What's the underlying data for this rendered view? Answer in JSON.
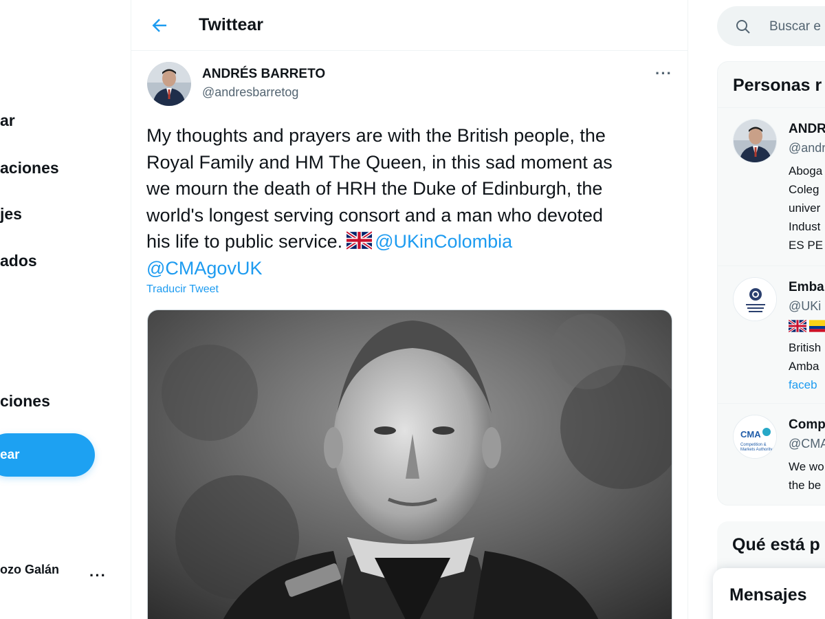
{
  "sidebar": {
    "items": [
      {
        "label": "ar"
      },
      {
        "label": "aciones"
      },
      {
        "label": "jes"
      },
      {
        "label": "ados"
      },
      {
        "label": "ciones"
      }
    ],
    "tweet_button": "ear",
    "account": {
      "name": "ozo Galán",
      "handle": "",
      "more": "···"
    }
  },
  "header": {
    "title": "Twittear"
  },
  "tweet": {
    "author_name": "ANDRÉS BARRETO",
    "author_handle": "@andresbarretog",
    "more": "···",
    "text_line1": "My thoughts and prayers are with the British people, the",
    "text_line2": "Royal Family and HM The Queen, in this sad moment as",
    "text_line3": "we mourn the death of HRH the Duke of Edinburgh, the",
    "text_line4": "world's longest serving consort and a man who devoted",
    "text_line5": "his life to public service.",
    "mention1": "@UKinColombia",
    "mention2": "@CMAgovUK",
    "translate": "Traducir Tweet"
  },
  "search": {
    "placeholder": "Buscar e"
  },
  "people": {
    "title": "Personas r",
    "list": [
      {
        "name": "ANDR",
        "handle": "@andr",
        "bio": [
          "Aboga",
          "Coleg",
          "univer",
          "Indust",
          "ES PE"
        ]
      },
      {
        "name": "Emba",
        "handle": "@UKi",
        "logo_text": "British Embassy Colombia",
        "bio": [
          "British",
          "Amba"
        ],
        "link": "faceb"
      },
      {
        "name": "Comp",
        "handle": "@CMA",
        "logo_text": "CMA",
        "logo_sub": "Competition & Markets Authority",
        "bio": [
          "We wo",
          "the be"
        ]
      }
    ]
  },
  "trends": {
    "title": "Qué está p"
  },
  "messages": {
    "title": "Mensajes"
  },
  "colors": {
    "accent": "#1d9bf0",
    "button": "#1da1f2",
    "text": "#0f1419",
    "muted": "#536471"
  }
}
